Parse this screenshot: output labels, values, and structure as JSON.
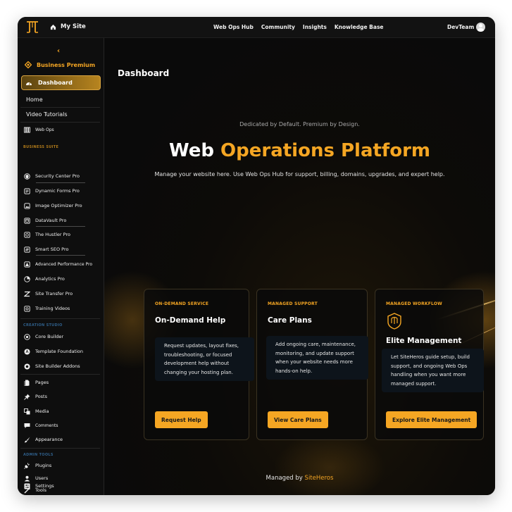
{
  "topbar": {
    "site_name": "My Site",
    "nav": [
      "Web Ops Hub",
      "Community",
      "Insights",
      "Knowledge Base"
    ],
    "user": "DevTeam"
  },
  "sidebar": {
    "collapse_glyph": "‹",
    "brand_label": "Business Premium",
    "active_item": "Dashboard",
    "sub_items": [
      "Home",
      "Video Tutorials"
    ],
    "web_ops": "Web Ops",
    "sections": {
      "business_suite": "BUSINESS SUITE",
      "creation_studio": "CREATION STUDIO",
      "admin_tools": "ADMIN TOOLS"
    },
    "business_items": [
      "Security Center Pro",
      "Dynamic Forms Pro",
      "Image Optimizer Pro",
      "DataVault Pro",
      "The Hustler Pro",
      "Smart SEO Pro",
      "Advanced Performance Pro",
      "Analytics Pro",
      "Site Transfer Pro",
      "Training Videos"
    ],
    "creation_items": [
      "Core Builder",
      "Template Foundation",
      "Site Builder Addons"
    ],
    "wp_items": [
      "Pages",
      "Posts",
      "Media",
      "Comments",
      "Appearance"
    ],
    "admin_items": [
      "Plugins",
      "Users",
      "Tools",
      "Settings"
    ]
  },
  "main": {
    "page_title": "Dashboard",
    "tagline": "Dedicated by Default. Premium by Design.",
    "hero_white": "Web ",
    "hero_accent": "Operations Platform",
    "hero_sub": "Manage your website here. Use Web Ops Hub for support, billing, domains, upgrades, and expert help.",
    "cards": [
      {
        "eyebrow": "ON-DEMAND SERVICE",
        "title": "On-Demand Help",
        "desc": "Request updates, layout fixes, troubleshooting, or focused development help without changing your hosting plan.",
        "button": "Request Help"
      },
      {
        "eyebrow": "MANAGED SUPPORT",
        "title": "Care Plans",
        "desc": "Add ongoing care, maintenance, monitoring, and update support when your website needs more hands-on help.",
        "button": "View Care Plans"
      },
      {
        "eyebrow": "MANAGED WORKFLOW",
        "title": "Elite Management",
        "desc": "Let SiteHeros guide setup, build support, and ongoing Web Ops handling when you want more managed support.",
        "button": "Explore Elite Management"
      }
    ],
    "managed_prefix": "Managed by ",
    "managed_brand": "SiteHeros"
  },
  "colors": {
    "accent": "#f5a623",
    "background": "#0b0b0b",
    "sidebar": "#0e0e0e",
    "section_business": "#b07a1a",
    "section_creation": "#2f5f8a"
  },
  "icons": {
    "logo": "pillar-logo-icon",
    "home": "home-icon",
    "avatar": "user-avatar-icon"
  }
}
